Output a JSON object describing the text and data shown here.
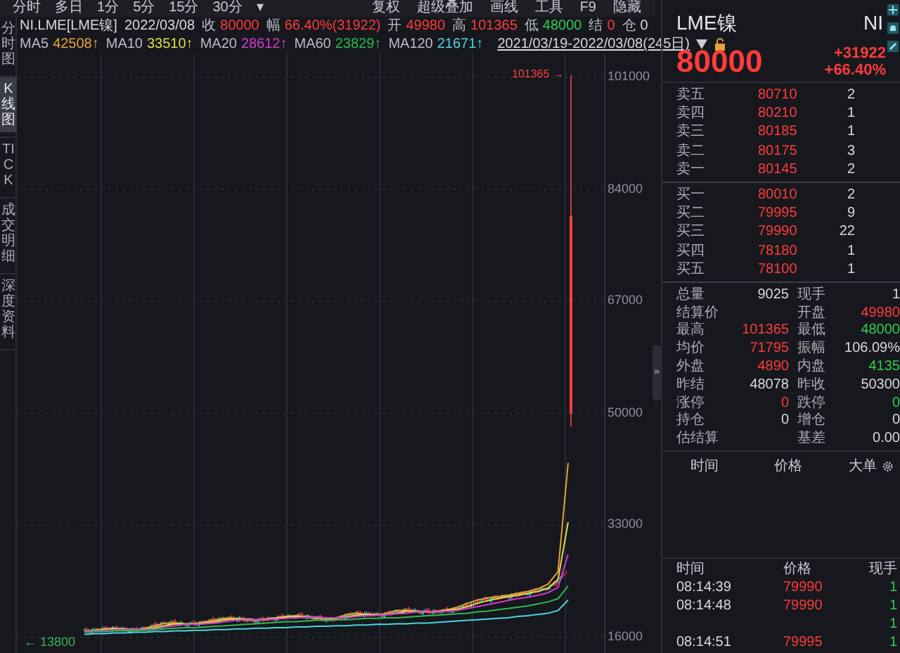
{
  "toolbar": {
    "left": [
      {
        "label": "分时"
      },
      {
        "label": "多日"
      },
      {
        "label": "1分"
      },
      {
        "label": "5分"
      },
      {
        "label": "15分"
      },
      {
        "label": "30分"
      },
      {
        "label": "▾"
      }
    ],
    "right": [
      {
        "label": "复权"
      },
      {
        "label": "超级叠加"
      },
      {
        "label": "画线"
      },
      {
        "label": "工具"
      },
      {
        "label": "F9"
      },
      {
        "label": "隐藏"
      }
    ]
  },
  "sidebar": [
    {
      "label": "分时图",
      "selected": false
    },
    {
      "label": "K线图",
      "selected": true
    },
    {
      "label": "TICK",
      "selected": false
    },
    {
      "label": "成交明细",
      "selected": false
    },
    {
      "label": "深度资料",
      "selected": false
    }
  ],
  "quote_line": {
    "symbol": "NI.LME[LME镍]",
    "date": "2022/03/08",
    "fields": [
      {
        "label": "收",
        "value": "80000",
        "color": "#ff3b3b"
      },
      {
        "label": "幅",
        "value": "66.40%(31922)",
        "color": "#ff3b3b"
      },
      {
        "label": "开",
        "value": "49980",
        "color": "#ff3b3b"
      },
      {
        "label": "高",
        "value": "101365",
        "color": "#ff3b3b"
      },
      {
        "label": "低",
        "value": "48000",
        "color": "#2ecc55"
      },
      {
        "label": "结",
        "value": "0",
        "color": "#ff3b3b"
      },
      {
        "label": "仓",
        "value": "0",
        "color": "#d6d9de"
      }
    ]
  },
  "ma_readings": [
    "42508↑",
    "33510↑",
    "28612↑",
    "23829↑",
    "21671↑"
  ],
  "date_range": "2021/03/19-2022/03/08(245日)",
  "chart": {
    "high_marker": "101365 →",
    "low_marker": "← 13800",
    "chart_data": {
      "type": "line",
      "grid": true,
      "ylim": [
        13651,
        104631
      ],
      "yticks": [
        16000,
        33000,
        50000,
        67000,
        84000,
        101000
      ],
      "series": [
        {
          "name": "MA5",
          "color": "#e8a23a",
          "values": [
            17000,
            17100,
            17300,
            17400,
            17200,
            17100,
            17400,
            17800,
            18200,
            18200,
            18000,
            18100,
            18400,
            18700,
            18900,
            18900,
            18600,
            18600,
            18800,
            19000,
            19200,
            19300,
            19100,
            18900,
            18700,
            18900,
            19500,
            19700,
            19500,
            19400,
            19700,
            20100,
            20100,
            19900,
            19900,
            20000,
            20200,
            20600,
            21200,
            21700,
            22000,
            22200,
            22400,
            22700,
            23000,
            23400,
            24100,
            26000,
            42508
          ]
        },
        {
          "name": "MA10",
          "color": "#e2dc4a",
          "values": [
            17000,
            17100,
            17200,
            17300,
            17300,
            17200,
            17200,
            17500,
            17800,
            18100,
            18100,
            18100,
            18200,
            18400,
            18700,
            18800,
            18800,
            18700,
            18700,
            18900,
            19100,
            19200,
            19200,
            19100,
            18900,
            18900,
            19100,
            19400,
            19500,
            19500,
            19500,
            19700,
            20000,
            20000,
            19900,
            19900,
            20100,
            20300,
            20700,
            21200,
            21600,
            21900,
            22200,
            22400,
            22700,
            23000,
            23500,
            24800,
            33510
          ]
        },
        {
          "name": "MA20",
          "color": "#d23ad6",
          "values": [
            17000,
            17000,
            17100,
            17200,
            17200,
            17200,
            17200,
            17300,
            17600,
            17800,
            18000,
            18000,
            18100,
            18200,
            18400,
            18600,
            18700,
            18700,
            18700,
            18800,
            18900,
            19000,
            19100,
            19100,
            19000,
            19000,
            19000,
            19200,
            19300,
            19400,
            19500,
            19600,
            19700,
            19900,
            19900,
            19900,
            20000,
            20100,
            20400,
            20700,
            21000,
            21300,
            21600,
            21900,
            22100,
            22400,
            22800,
            23600,
            28612
          ]
        },
        {
          "name": "MA60",
          "color": "#2fb84f",
          "values": [
            16800,
            16900,
            16900,
            17000,
            17000,
            17100,
            17100,
            17200,
            17300,
            17400,
            17500,
            17500,
            17600,
            17700,
            17800,
            17900,
            18000,
            18100,
            18200,
            18300,
            18400,
            18400,
            18500,
            18600,
            18600,
            18700,
            18700,
            18800,
            18900,
            18900,
            19000,
            19000,
            19100,
            19200,
            19300,
            19400,
            19500,
            19600,
            19700,
            19900,
            20000,
            20200,
            20400,
            20600,
            20800,
            21100,
            21400,
            21900,
            23829
          ]
        },
        {
          "name": "MA120",
          "color": "#4fd3df",
          "values": [
            16500,
            16600,
            16600,
            16700,
            16700,
            16800,
            16800,
            16900,
            16900,
            17000,
            17000,
            17100,
            17100,
            17200,
            17200,
            17300,
            17300,
            17400,
            17400,
            17500,
            17500,
            17600,
            17600,
            17700,
            17700,
            17800,
            17800,
            17900,
            17900,
            18000,
            18000,
            18100,
            18100,
            18200,
            18200,
            18300,
            18400,
            18500,
            18600,
            18700,
            18800,
            18900,
            19000,
            19200,
            19300,
            19500,
            19700,
            20100,
            21671
          ]
        }
      ]
    }
  },
  "collapse_handle": "»",
  "quote_panel": {
    "name": "LME镍",
    "code": "NI",
    "price": "80000",
    "change": "+31922",
    "change_pct": "+66.40%",
    "asks": [
      {
        "label": "卖五",
        "price": "80710",
        "volume": "2"
      },
      {
        "label": "卖四",
        "price": "80210",
        "volume": "1"
      },
      {
        "label": "卖三",
        "price": "80185",
        "volume": "1"
      },
      {
        "label": "卖二",
        "price": "80175",
        "volume": "3"
      },
      {
        "label": "卖一",
        "price": "80145",
        "volume": "2"
      }
    ],
    "bids": [
      {
        "label": "买一",
        "price": "80010",
        "volume": "2"
      },
      {
        "label": "买二",
        "price": "79995",
        "volume": "9"
      },
      {
        "label": "买三",
        "price": "79990",
        "volume": "22"
      },
      {
        "label": "买四",
        "price": "78180",
        "volume": "1"
      },
      {
        "label": "买五",
        "price": "78100",
        "volume": "1"
      }
    ],
    "stats": [
      [
        {
          "label": "总量",
          "value": "9025",
          "color": "#d6d9de"
        },
        {
          "label": "现手",
          "value": "1",
          "color": "#d6d9de"
        }
      ],
      [
        {
          "label": "结算价"
        },
        {
          "label": "开盘",
          "value": "49980",
          "color": "#ff3b3b"
        }
      ],
      [
        {
          "label": "最高",
          "value": "101365",
          "color": "#ff3b3b"
        },
        {
          "label": "最低",
          "value": "48000",
          "color": "#2ecc55"
        }
      ],
      [
        {
          "label": "均价",
          "value": "71795",
          "color": "#ff3b3b"
        },
        {
          "label": "振幅",
          "value": "106.09%",
          "color": "#d6d9de"
        }
      ],
      [
        {
          "label": "外盘",
          "value": "4890",
          "color": "#ff3b3b"
        },
        {
          "label": "内盘",
          "value": "4135",
          "color": "#2ecc55"
        }
      ],
      [
        {
          "label": "昨结",
          "value": "48078",
          "color": "#d6d9de"
        },
        {
          "label": "昨收",
          "value": "50300",
          "color": "#d6d9de"
        }
      ],
      [
        {
          "label": "涨停",
          "value": "0",
          "color": "#ff3b3b"
        },
        {
          "label": "跌停",
          "value": "0",
          "color": "#2ecc55"
        }
      ],
      [
        {
          "label": "持仓",
          "value": "0",
          "color": "#d6d9de"
        },
        {
          "label": "增仓",
          "value": "0",
          "color": "#d6d9de"
        }
      ],
      [
        {
          "label": "估结算"
        },
        {
          "label": "基差",
          "value": "0.00",
          "color": "#d6d9de"
        }
      ]
    ],
    "big_orders": {
      "columns": [
        "时间",
        "价格",
        "大单"
      ]
    },
    "trades": {
      "columns": [
        "时间",
        "价格",
        "现手"
      ],
      "rows": [
        {
          "time": "08:14:39",
          "price": "79990",
          "volume": "1"
        },
        {
          "time": "08:14:48",
          "price": "79990",
          "volume": "1"
        },
        {
          "volume": "1"
        },
        {
          "time": "08:14:51",
          "price": "79995",
          "volume": "1"
        }
      ]
    }
  }
}
